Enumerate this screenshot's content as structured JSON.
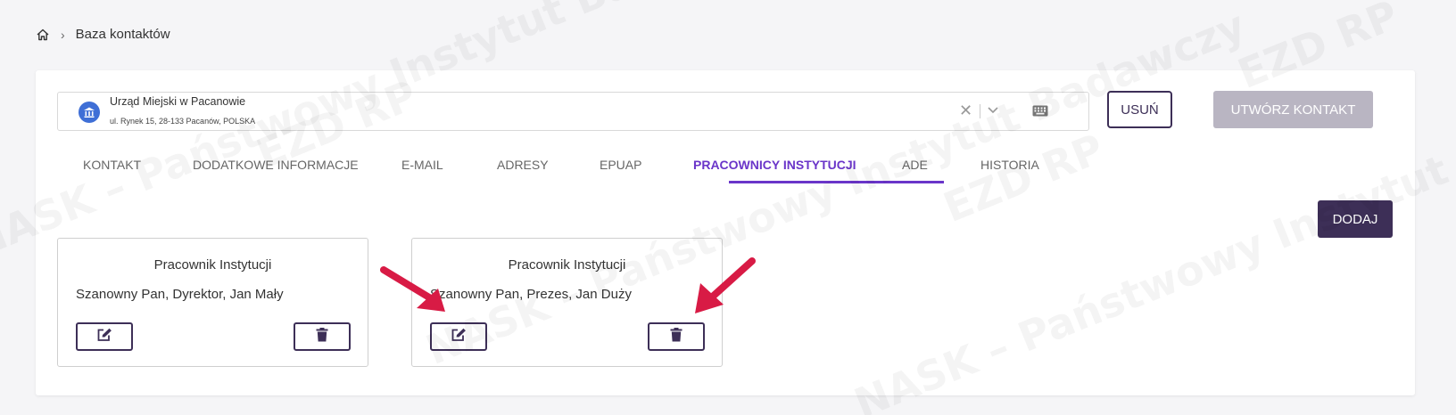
{
  "breadcrumb": {
    "home_icon": "home-icon",
    "current": "Baza kontaktów"
  },
  "contact": {
    "name": "Urząd Miejski w Pacanowie",
    "address": "ul. Rynek 15, 28-133 Pacanów, POLSKA",
    "avatar_icon": "institution-icon"
  },
  "actions": {
    "delete_label": "USUŃ",
    "create_label": "UTWÓRZ KONTAKT"
  },
  "tabs": [
    {
      "label": "KONTAKT",
      "active": false
    },
    {
      "label": "DODATKOWE INFORMACJE",
      "active": false
    },
    {
      "label": "E-MAIL",
      "active": false
    },
    {
      "label": "ADRESY",
      "active": false
    },
    {
      "label": "EPUAP",
      "active": false
    },
    {
      "label": "PRACOWNICY INSTYTUCJI",
      "active": true
    },
    {
      "label": "ADE",
      "active": false
    },
    {
      "label": "HISTORIA",
      "active": false
    }
  ],
  "add_label": "DODAJ",
  "employees": [
    {
      "title": "Pracownik Instytucji",
      "person": "Szanowny Pan, Dyrektor, Jan Mały"
    },
    {
      "title": "Pracownik Instytucji",
      "person": "Szanowny Pan, Prezes, Jan Duży"
    }
  ],
  "watermark": {
    "line1": "NASK – Państwowy Instytut Badawczy",
    "logo": "EZD RP"
  },
  "colors": {
    "accent": "#6a35c9",
    "primary": "#3d2f57",
    "annotation": "#d81b45",
    "disabled": "#b9b5c2"
  }
}
